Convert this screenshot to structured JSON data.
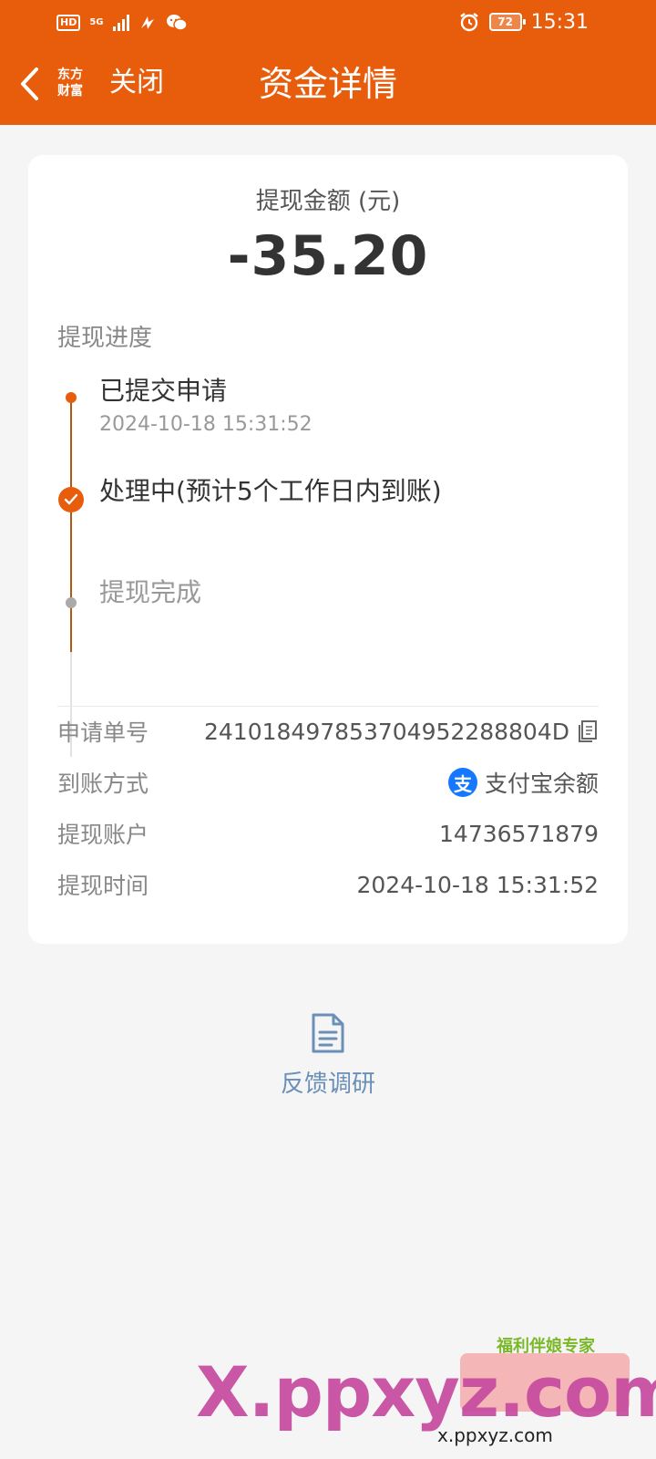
{
  "status_bar": {
    "hd": "HD",
    "network": "5G",
    "battery": "72",
    "time": "15:31"
  },
  "nav": {
    "logo_line1": "东方",
    "logo_line2": "财富",
    "close_label": "关闭",
    "title": "资金详情"
  },
  "detail": {
    "amount_label": "提现金额 (元)",
    "amount": "-35.20",
    "progress_title": "提现进度",
    "steps": [
      {
        "label": "已提交申请",
        "time": "2024-10-18 15:31:52"
      },
      {
        "label": "处理中(预计5个工作日内到账)"
      },
      {
        "label": "提现完成"
      }
    ],
    "info": [
      {
        "label": "申请单号",
        "value": "241018497853704952288804D"
      },
      {
        "label": "到账方式",
        "value": "支付宝余额",
        "icon_glyph": "支"
      },
      {
        "label": "提现账户",
        "value": "14736571879"
      },
      {
        "label": "提现时间",
        "value": "2024-10-18 15:31:52"
      }
    ]
  },
  "feedback": {
    "label": "反馈调研"
  },
  "watermark": {
    "main": "X.ppxyz.com",
    "tag": "福利伴娘专家",
    "url": "x.ppxyz.com"
  },
  "colors": {
    "brand": "#e85d0c",
    "background": "#f5f5f5",
    "alipay": "#1677ff",
    "feedback": "#6b8fb8"
  }
}
